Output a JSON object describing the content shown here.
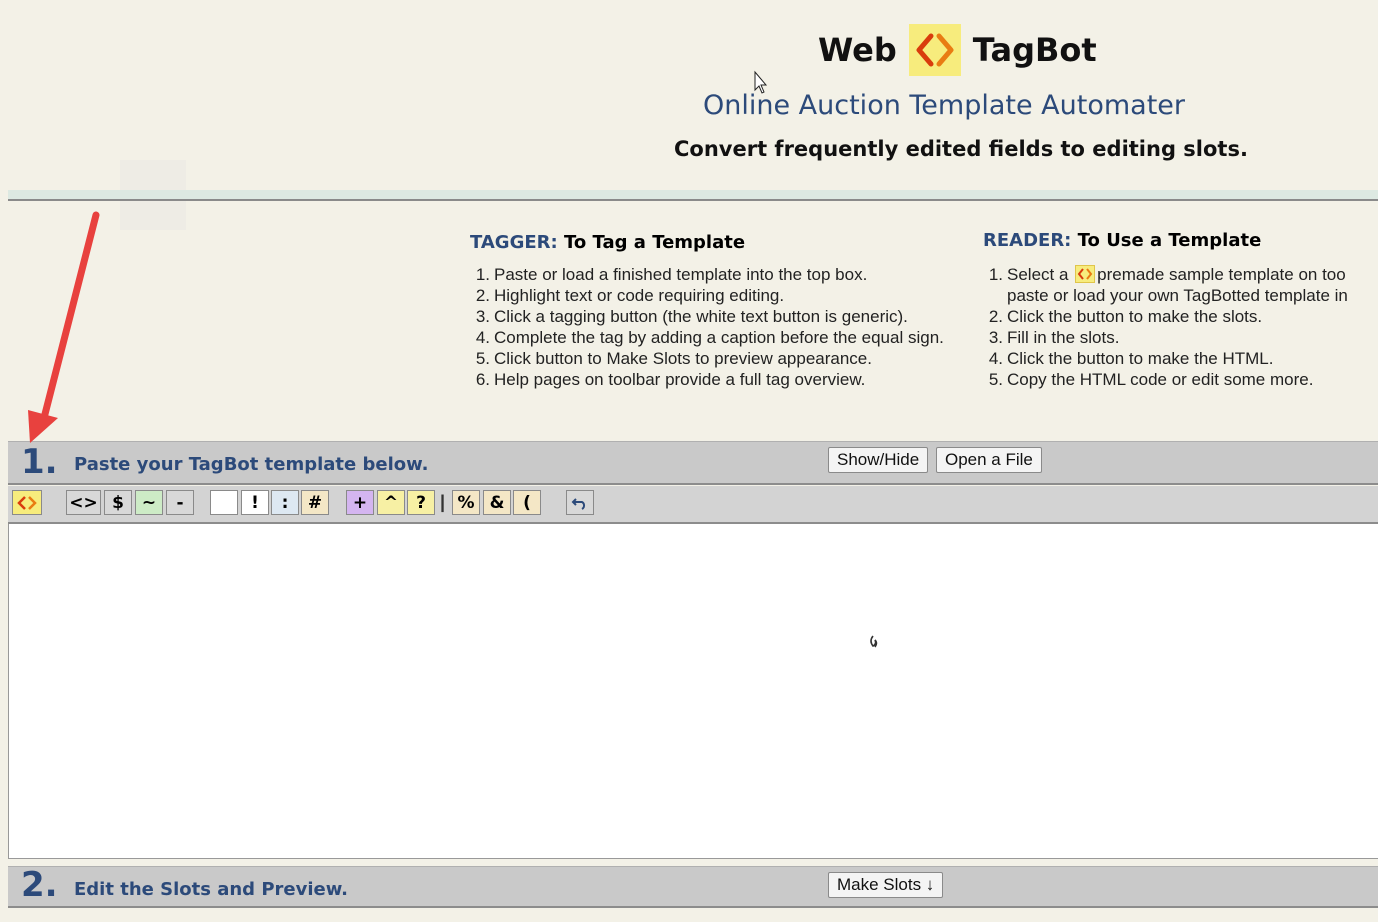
{
  "header": {
    "title_left": "Web",
    "title_right": "TagBot",
    "logo_icon": "tagbot-logo-icon",
    "subtitle": "Online Auction Template Automater",
    "tagline": "Convert frequently edited fields to editing slots."
  },
  "tagger": {
    "heading_key": "TAGGER:",
    "heading_rest": "To Tag a Template",
    "steps": [
      "Paste or load a finished template into the top box.",
      "Highlight text or code requiring editing.",
      "Click a tagging button (the white text button is generic).",
      "Complete the tag by adding a caption before the equal sign.",
      "Click button to Make Slots to preview appearance.",
      "Help pages on toolbar provide a full tag overview."
    ]
  },
  "reader": {
    "heading_key": "READER:",
    "heading_rest": "To Use a Template",
    "step1_a": "Select a",
    "step1_b": "premade sample template on too",
    "step1_cont": "paste or load your own TagBotted template in",
    "steps": [
      "Click the button to make the slots.",
      "Fill in the slots.",
      "Click the button to make the HTML.",
      "Copy the HTML code or edit some more."
    ]
  },
  "step1": {
    "number": "1.",
    "label": "Paste your TagBot template below.",
    "show_hide": "Show/Hide",
    "open_file": "Open a File"
  },
  "toolbar": {
    "buttons": [
      {
        "label": "<>",
        "color": "#d8d8d8"
      },
      {
        "label": "$",
        "color": "#d8d8d8"
      },
      {
        "label": "~",
        "color": "#cdebc6"
      },
      {
        "label": "-",
        "color": "#d8d8d8"
      },
      {
        "label": "",
        "color": "#ffffff"
      },
      {
        "label": "!",
        "color": "#ffffff"
      },
      {
        "label": ":",
        "color": "#dde8f2"
      },
      {
        "label": "#",
        "color": "#f4e7c6"
      },
      {
        "label": "+",
        "color": "#d4b5f0"
      },
      {
        "label": "^",
        "color": "#f7f0a4"
      },
      {
        "label": "?",
        "color": "#f7f0a4"
      },
      {
        "label": "%",
        "color": "#f4e7c6"
      },
      {
        "label": "&",
        "color": "#f4e7c6"
      },
      {
        "label": "(",
        "color": "#f4e7c6"
      }
    ],
    "separator": "|",
    "undo_icon": "undo-icon"
  },
  "editor": {
    "value": ""
  },
  "step2": {
    "number": "2.",
    "label": "Edit the Slots and Preview.",
    "make_slots": "Make Slots ↓"
  },
  "colors": {
    "accent": "#2c4a7a",
    "background": "#f3f1e7",
    "bar": "#c9c9c9",
    "arrow": "#e8413e"
  }
}
